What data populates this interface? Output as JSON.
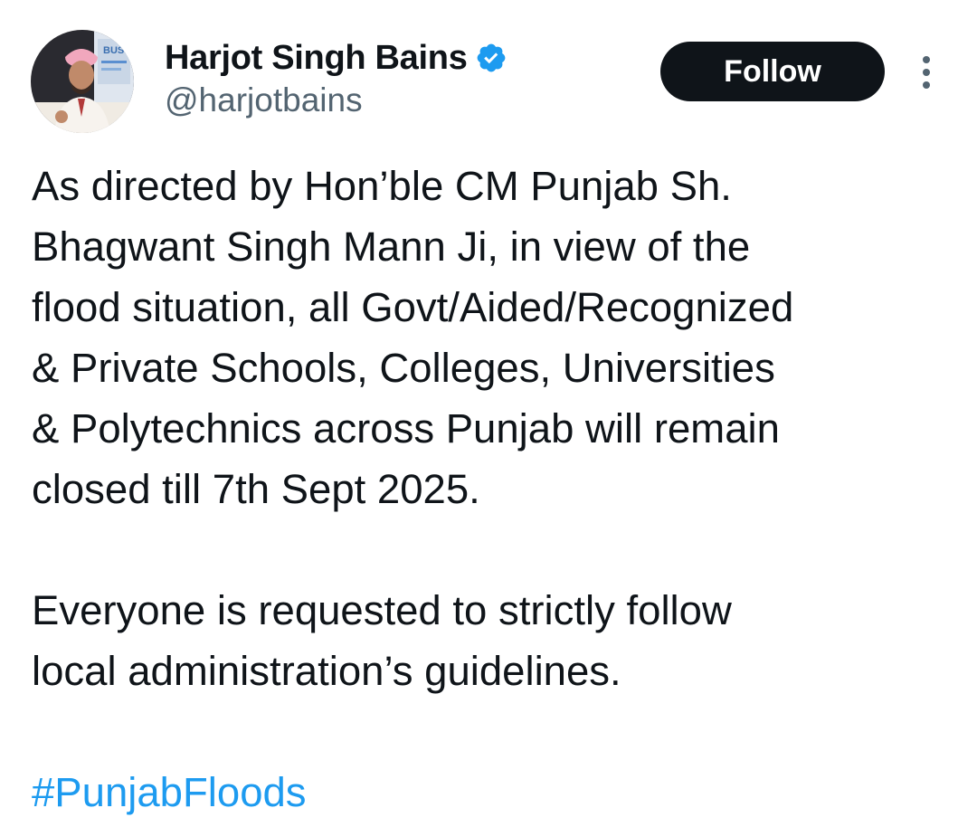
{
  "author": {
    "display_name": "Harjot Singh Bains",
    "handle": "@harjotbains",
    "verified": true,
    "verified_icon": "verified-badge-icon",
    "avatar_icon": "profile-avatar"
  },
  "actions": {
    "follow_label": "Follow",
    "more_icon": "more-options-icon"
  },
  "tweet": {
    "paragraph_1_lines": [
      "As directed by Hon’ble CM Punjab Sh.",
      "Bhagwant Singh Mann Ji, in view of the",
      "flood situation, all Govt/Aided/Recognized",
      "& Private Schools, Colleges, Universities",
      "& Polytechnics across Punjab will remain",
      "closed till 7th Sept 2025."
    ],
    "paragraph_2_lines": [
      "Everyone is requested to strictly follow",
      "local administration’s guidelines."
    ],
    "hashtag": "#PunjabFloods"
  },
  "colors": {
    "text": "#0f1419",
    "secondary": "#536471",
    "link": "#1d9bf0",
    "verified": "#1d9bf0",
    "follow_bg": "#0f1419"
  }
}
